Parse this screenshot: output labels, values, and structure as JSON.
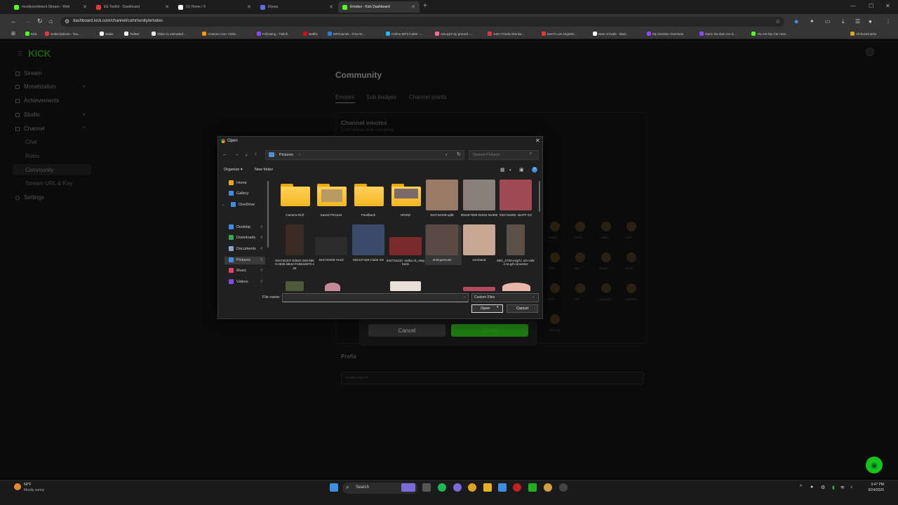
{
  "browser": {
    "tabs": [
      {
        "title": "mostlysentiment Stream - Web",
        "color": "#53fc18"
      },
      {
        "title": "EE Toolkit - Dashboard",
        "color": "#e53935"
      },
      {
        "title": "(1) Home / X",
        "color": "#ffffff"
      },
      {
        "title": "Elyara",
        "color": "#5b6ee1"
      },
      {
        "title": "Emotes - Kick Dashboard",
        "color": "#53fc18"
      }
    ],
    "url": "dashboard.kick.com/channel/community/emotes",
    "bookmarks": [
      {
        "label": "Kick",
        "color": "#53fc18"
      },
      {
        "label": "Subscriptions - You...",
        "color": "#e53935"
      },
      {
        "label": "Stake",
        "color": "#ffffff"
      },
      {
        "label": "Twitter",
        "color": "#ffffff"
      },
      {
        "label": "Video to animated...",
        "color": "#e9e9e9"
      },
      {
        "label": "Amazon.com: Onlin...",
        "color": "#ff9900"
      },
      {
        "label": "Following - Twitch",
        "color": "#9146ff"
      },
      {
        "label": "Netflix",
        "color": "#e50914"
      },
      {
        "label": "MP3Juices - Free M...",
        "color": "#2b7de9"
      },
      {
        "label": "Online MP3 Cutter -...",
        "color": "#29b6f6"
      },
      {
        "label": "osu-pp's by ground -...",
        "color": "#ff66aa"
      },
      {
        "label": "John Frieda Intense...",
        "color": "#e53935"
      },
      {
        "label": "Men's Los Angeles...",
        "color": "#e53935"
      },
      {
        "label": "New Arrivals - Mad...",
        "color": "#ffffff"
      },
      {
        "label": "My Session Overview",
        "color": "#9146ff"
      },
      {
        "label": "Open Da dam car d...",
        "color": "#9146ff"
      },
      {
        "label": "You Hit My Car near...",
        "color": "#53fc18"
      }
    ],
    "all_bookmarks": "All Bookmarks"
  },
  "dashboard": {
    "logo": "KICK",
    "nav": [
      {
        "label": "Stream"
      },
      {
        "label": "Monetization",
        "chevron": "v"
      },
      {
        "label": "Achievements"
      },
      {
        "label": "Studio",
        "chevron": "v"
      },
      {
        "label": "Channel",
        "chevron": "^"
      }
    ],
    "channel_sub": [
      "Chat",
      "Roles",
      "Community",
      "Stream URL & Key"
    ],
    "settings": "Settings",
    "heading": "Community",
    "tabs": [
      "Emotes",
      "Sub badges",
      "Channel points"
    ],
    "emotes_title": "Channel emotes",
    "emotes_subtitle": "22/60 emote slots remaining",
    "emote_labels": [
      "casch",
      "casch...",
      "cadkin",
      "casdi",
      "fiery",
      "Jaw",
      "awell",
      "KKKK",
      "lock",
      "Fuh",
      "penguin",
      "question",
      "222hogs"
    ],
    "cancel": "Cancel",
    "save": "Save",
    "prefix_title": "Prefix",
    "prefix_value": "mostlsergred"
  },
  "dialog": {
    "title": "Open",
    "path": "Pictures",
    "search_placeholder": "Search Pictures",
    "organize": "Organize",
    "new_folder": "New folder",
    "nav": [
      {
        "label": "Home",
        "color": "#e8a915"
      },
      {
        "label": "Gallery",
        "color": "#3d8de0"
      },
      {
        "label": "OneDrive",
        "color": "#3d8de0"
      },
      {
        "label": "Desktop",
        "color": "#3d8de0"
      },
      {
        "label": "Downloads",
        "color": "#2fa84f"
      },
      {
        "label": "Documents",
        "color": "#8aa6c8"
      },
      {
        "label": "Pictures",
        "color": "#3d8de0"
      },
      {
        "label": "Music",
        "color": "#e0446a"
      },
      {
        "label": "Videos",
        "color": "#7c4ddb"
      }
    ],
    "files": [
      {
        "name": "Camera Roll",
        "kind": "folder"
      },
      {
        "name": "Saved Pictures",
        "kind": "folder"
      },
      {
        "name": "Feedback",
        "kind": "folder"
      },
      {
        "name": "HINGE",
        "kind": "folder"
      },
      {
        "name": "934734108-upl6",
        "kind": "image",
        "color": "#9a7a66"
      },
      {
        "name": "0621E7828-02022 MU00I",
        "kind": "image",
        "color": "#8a7f78"
      },
      {
        "name": "934734205 -ok4TF EZ",
        "kind": "image",
        "color": "#a04a55"
      },
      {
        "name": "934734207-83503 083-0800-4935-9B42-F36B44879 42E",
        "kind": "image",
        "color": "#3a2a24"
      },
      {
        "name": "934734208 Huzd",
        "kind": "image",
        "color": "#2c2c2c"
      },
      {
        "name": "062137428 Club5 XD",
        "kind": "image",
        "color": "#3a4a6a"
      },
      {
        "name": "934734210 -ostba ck_stepbeck",
        "kind": "image",
        "color": "#7a2a2a"
      },
      {
        "name": "ohnlupeHusz",
        "kind": "image",
        "color": "#5a4a44"
      },
      {
        "name": "somband",
        "kind": "image",
        "color": "#c8a895"
      },
      {
        "name": "IMG_4730-ezgif.c om-video-to-gif-converter",
        "kind": "image",
        "color": "#5a5048"
      }
    ],
    "file_name_label": "File name:",
    "file_name_value": "",
    "file_type": "Custom Files",
    "open": "Open",
    "cancel": "Cancel"
  },
  "taskbar": {
    "weather_temp": "69°F",
    "weather_desc": "Mostly sunny",
    "search": "Search",
    "time": "3:47 PM",
    "date": "8/24/2025"
  }
}
